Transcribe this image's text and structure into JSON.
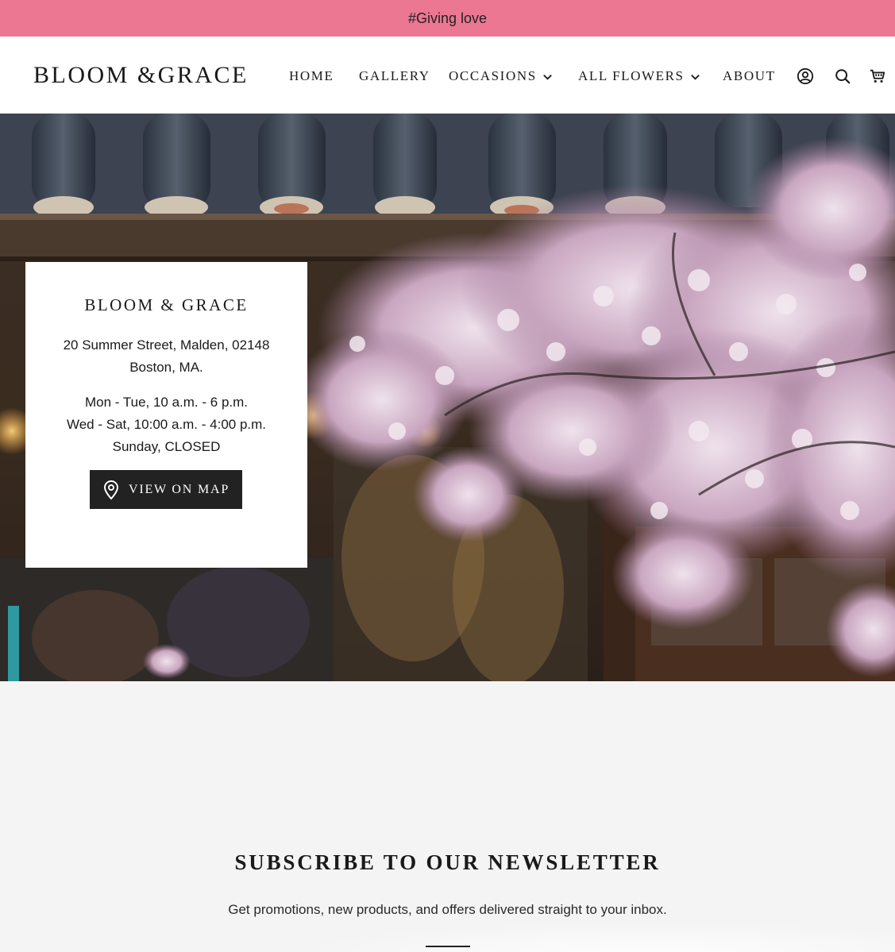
{
  "announcement": {
    "text": "#Giving love"
  },
  "header": {
    "logo": "BLOOM &GRACE",
    "nav": {
      "home": "HOME",
      "gallery": "GALLERY",
      "occasions": "OCCASIONS",
      "all_flowers": "ALL FLOWERS",
      "about": "ABOUT"
    },
    "icons": [
      "account-icon",
      "search-icon",
      "cart-icon"
    ]
  },
  "hero": {
    "image_subject": "cherry blossoms under tiled roof",
    "info": {
      "title": "BLOOM & GRACE",
      "address_line1": "20 Summer Street, Malden, 02148",
      "address_line2": "Boston, MA.",
      "hours_line1": "Mon - Tue, 10 a.m. - 6 p.m.",
      "hours_line2": "Wed - Sat, 10:00 a.m. - 4:00 p.m.",
      "hours_line3": "Sunday, CLOSED",
      "map_button": "VIEW ON MAP"
    }
  },
  "newsletter": {
    "title": "SUBSCRIBE TO OUR NEWSLETTER",
    "subtitle": "Get promotions, new products, and offers delivered straight to your inbox."
  },
  "colors": {
    "announcement_bg": "#ec7793",
    "button_bg": "#222222",
    "page_bg": "#f4f4f4"
  }
}
